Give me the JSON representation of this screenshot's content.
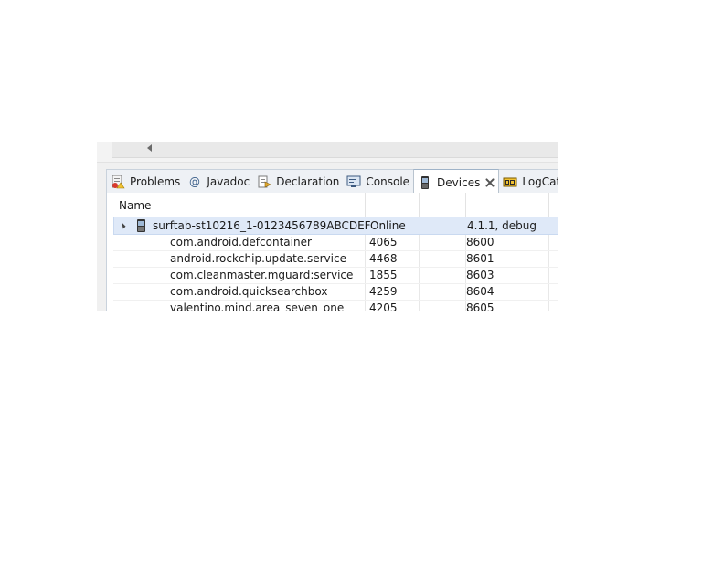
{
  "tabs": [
    {
      "label": "Problems",
      "icon": "problems-icon"
    },
    {
      "label": "Javadoc",
      "icon": "at-icon"
    },
    {
      "label": "Declaration",
      "icon": "declaration-icon"
    },
    {
      "label": "Console",
      "icon": "console-icon"
    },
    {
      "label": "Devices",
      "icon": "device-icon",
      "active": true
    },
    {
      "label": "LogCat",
      "icon": "logcat-icon"
    }
  ],
  "table": {
    "column_name": "Name",
    "device": {
      "name": "surftab-st10216_1-0123456789ABCDEF",
      "state": "Online",
      "build": "4.1.1, debug"
    },
    "processes": [
      {
        "name": "com.android.defcontainer",
        "pid": "4065",
        "port": "8600"
      },
      {
        "name": "android.rockchip.update.service",
        "pid": "4468",
        "port": "8601"
      },
      {
        "name": "com.cleanmaster.mguard:service",
        "pid": "1855",
        "port": "8603"
      },
      {
        "name": "com.android.quicksearchbox",
        "pid": "4259",
        "port": "8604"
      },
      {
        "name": "valentino.mind.area_seven_one",
        "pid": "4205",
        "port": "8605"
      }
    ]
  },
  "colors": {
    "selection": "#dfe9f8",
    "tab_border": "#c9d2dc"
  }
}
